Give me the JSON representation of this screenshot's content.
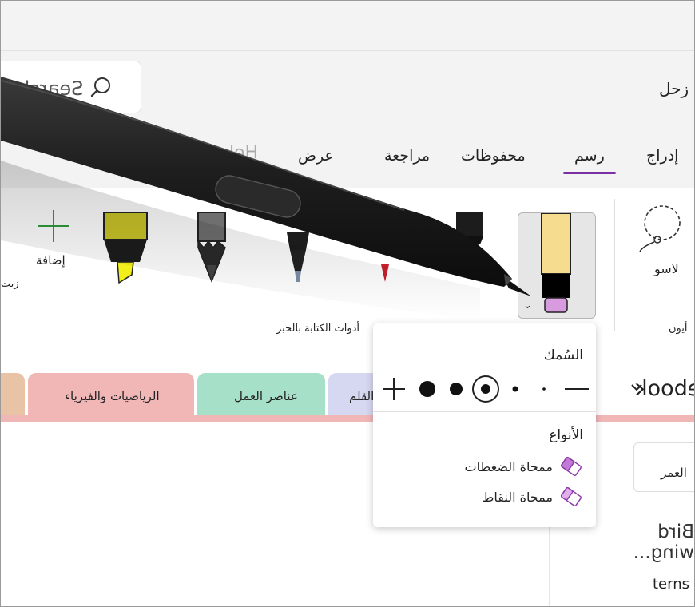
{
  "header": {
    "user_name": "زحل",
    "search_text": "Search"
  },
  "menu": {
    "tabs": [
      {
        "label": "إدراج",
        "active": false
      },
      {
        "label": "رسم",
        "active": true
      },
      {
        "label": "محفوظات",
        "active": false
      },
      {
        "label": "مراجعة",
        "active": false
      },
      {
        "label": "عرض",
        "active": false
      }
    ],
    "help": "Help"
  },
  "ribbon": {
    "lasso_label": "لاسو",
    "right_group_label": "أيون",
    "ink_group_label": "أدوات الكتابة بالحبر",
    "add_label": "إضافة",
    "oil_label": "زيت"
  },
  "eraser_popup": {
    "thickness_title": "السُمك",
    "types_title": "الأنواع",
    "types": [
      "ممحاة الضغطات",
      "ممحاة النقاط"
    ]
  },
  "notebook": {
    "name": "Notebook",
    "sections": [
      "الرياضيات والفيزياء",
      "عناصر العمل",
      "القلم"
    ],
    "page_chip": "العمر",
    "page_preview": "Bird wing...",
    "partial_text": "terns"
  },
  "colors": {
    "accent": "#7b2fa5",
    "section_math": "#f1b7b7",
    "section_work": "#a7e0c9",
    "section_pen": "#d6d7f0",
    "section_left": "#e9c3a5"
  }
}
